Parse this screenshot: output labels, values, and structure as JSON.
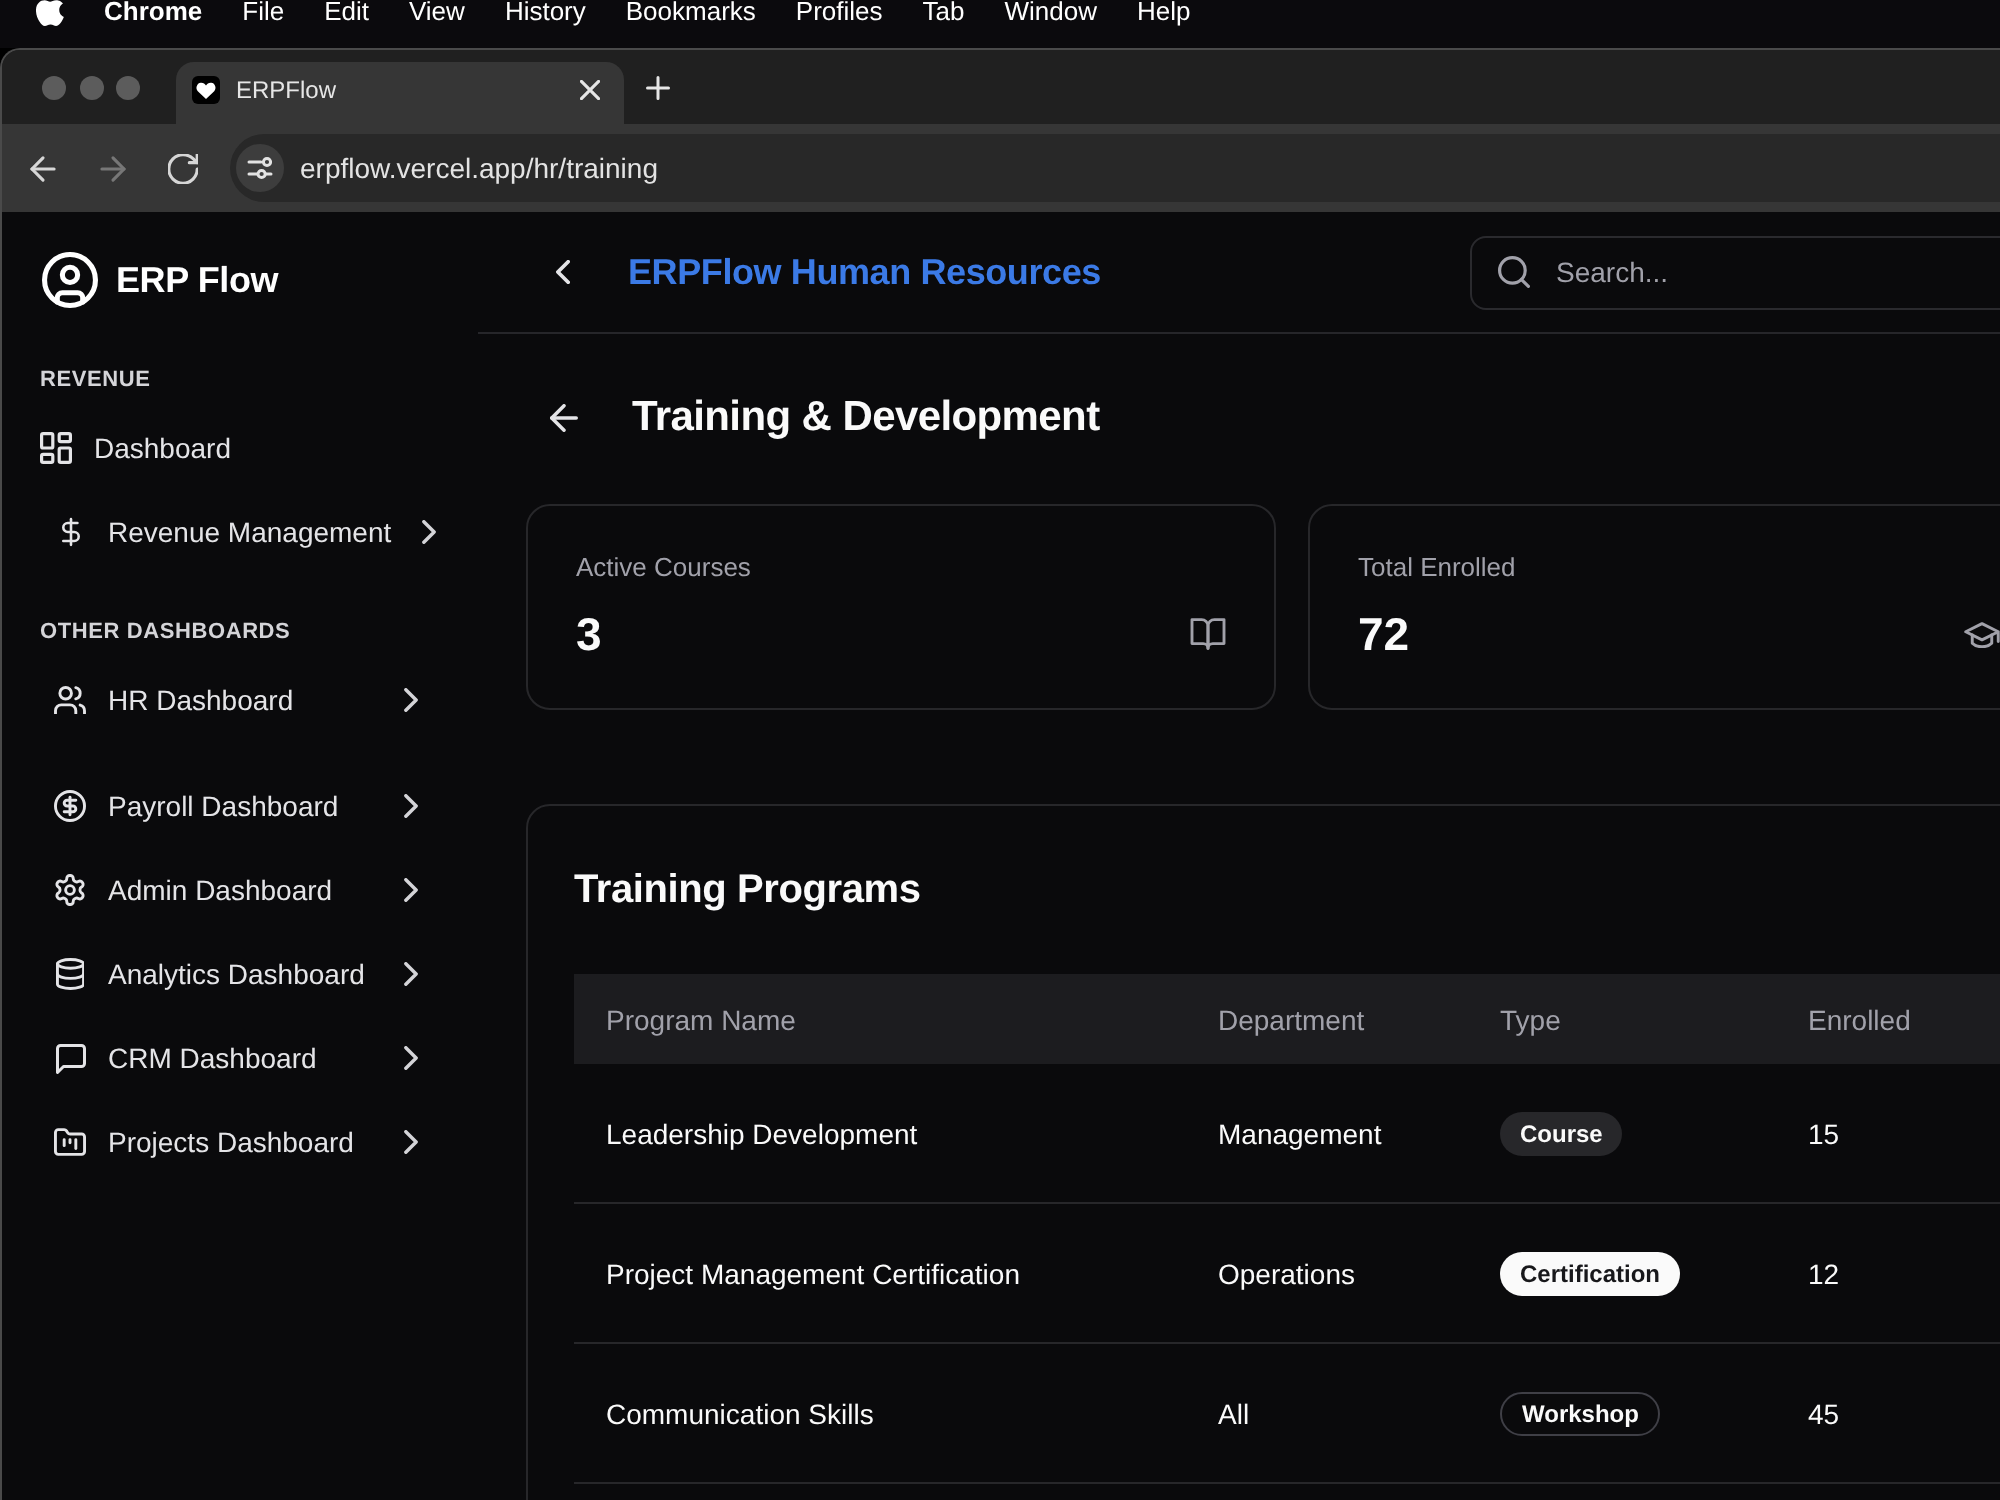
{
  "menu_bar": {
    "app_name": "Chrome",
    "items": [
      "File",
      "Edit",
      "View",
      "History",
      "Bookmarks",
      "Profiles",
      "Tab",
      "Window",
      "Help"
    ]
  },
  "browser": {
    "tabs": [
      {
        "title": "ERPFlow",
        "selected": true
      }
    ],
    "nav_buttons": [
      {
        "kind": "back",
        "disabled": false
      },
      {
        "kind": "forward",
        "disabled": true
      },
      {
        "kind": "reload",
        "disabled": false
      }
    ],
    "address": "erpflow.vercel.app/hr/training"
  },
  "sidebar": {
    "brand": "ERP Flow",
    "sections": [
      {
        "label": "REVENUE",
        "items": [
          {
            "label": "Dashboard",
            "kind": "link"
          },
          {
            "label": "Revenue Management",
            "kind": "menu"
          }
        ]
      },
      {
        "label": "OTHER DASHBOARDS",
        "items": [
          {
            "label": "HR Dashboard",
            "kind": "menu"
          },
          {
            "label": "Payroll Dashboard",
            "kind": "menu"
          },
          {
            "label": "Admin Dashboard",
            "kind": "menu"
          },
          {
            "label": "Analytics Dashboard",
            "kind": "menu"
          },
          {
            "label": "CRM Dashboard",
            "kind": "menu"
          },
          {
            "label": "Projects Dashboard",
            "kind": "menu"
          }
        ]
      }
    ]
  },
  "header": {
    "title": "ERPFlow Human Resources",
    "search": {
      "placeholder": "Search..."
    }
  },
  "page": {
    "title": "Training & Development",
    "stats": [
      {
        "label": "Active Courses",
        "value": "3"
      },
      {
        "label": "Total Enrolled",
        "value": "72"
      }
    ],
    "programs": {
      "title": "Training Programs",
      "columns": [
        "Program Name",
        "Department",
        "Type",
        "Enrolled"
      ],
      "rows": [
        {
          "name": "Leadership Development",
          "department": "Management",
          "type": {
            "label": "Course",
            "kind": "secondary"
          },
          "enrolled": "15"
        },
        {
          "name": "Project Management Certification",
          "department": "Operations",
          "type": {
            "label": "Certification",
            "kind": "primary"
          },
          "enrolled": "12"
        },
        {
          "name": "Communication Skills",
          "department": "All",
          "type": {
            "label": "Workshop",
            "kind": "outline"
          },
          "enrolled": "45"
        }
      ]
    }
  }
}
